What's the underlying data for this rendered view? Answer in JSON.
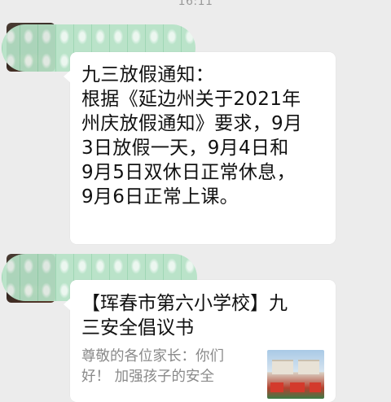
{
  "status_bar": {
    "time": "16:11"
  },
  "messages": [
    {
      "lines": [
        "九三放假通知：",
        "根据《延边州关于2021年",
        "州庆放假通知》要求，9月",
        "3日放假一天，9月4日和",
        "9月5日双休日正常休息，",
        "9月6日正常上课。"
      ]
    },
    {
      "type": "link_card",
      "title_lines": [
        "【珲春市第六小学校】九",
        "三安全倡议书"
      ],
      "desc_lines": [
        "尊敬的各位家长：你们",
        "好！ 加强孩子的安全"
      ],
      "thumbnail": "school-photo"
    }
  ],
  "colors": {
    "background": "#ececec",
    "bubble": "#ffffff",
    "name_mask": "#b6e3c7",
    "desc_text": "#8a8a8a"
  }
}
